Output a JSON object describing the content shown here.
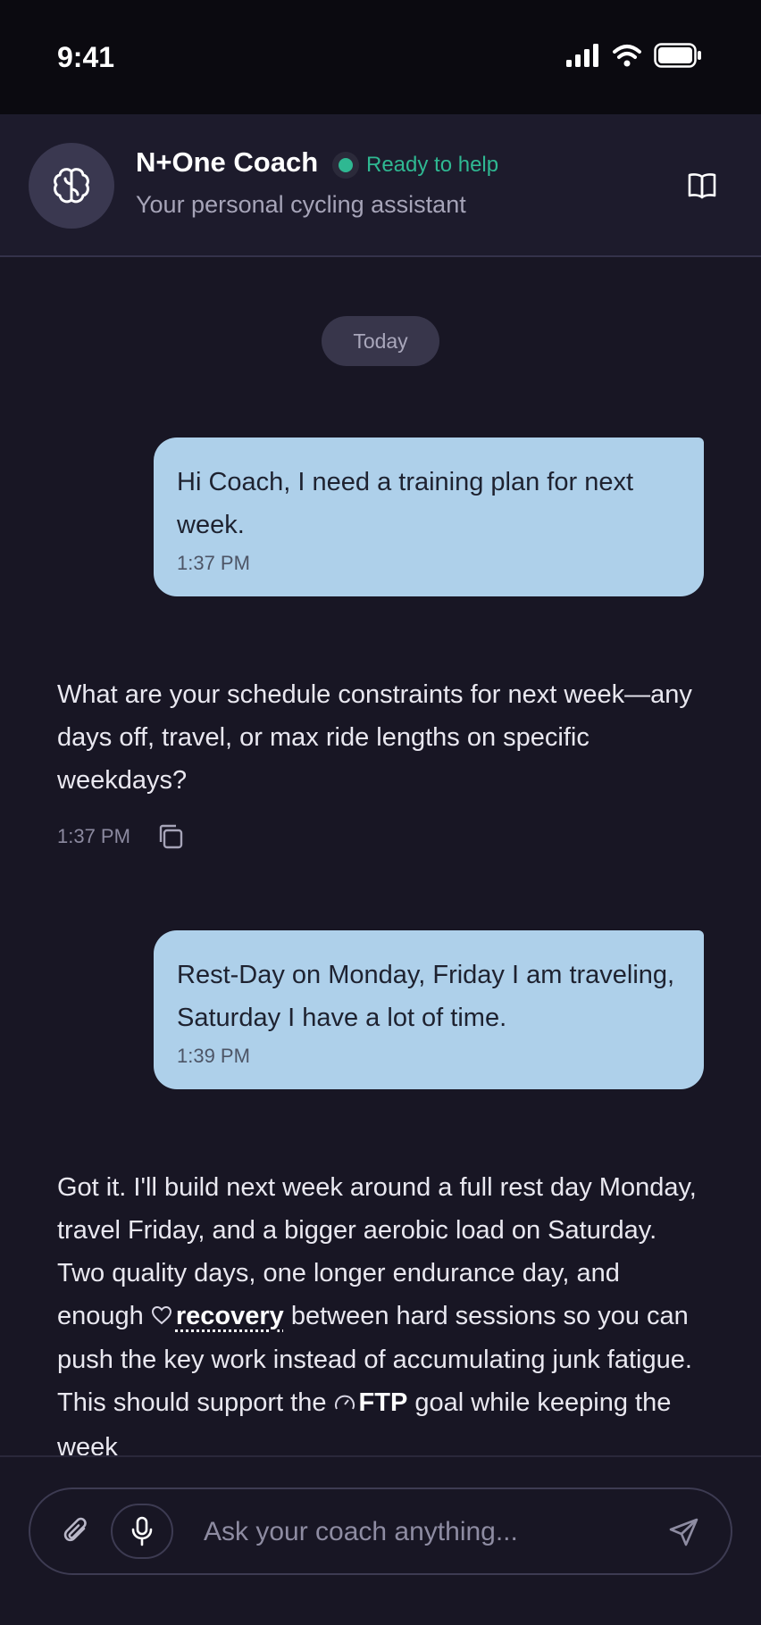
{
  "status_bar": {
    "time": "9:41",
    "icons": [
      "signal-icon",
      "wifi-icon",
      "battery-icon"
    ]
  },
  "header": {
    "coach_name": "N+One Coach",
    "status": "Ready to help",
    "subtitle": "Your personal cycling assistant",
    "avatar_icon": "brain-icon",
    "action_icon": "book-icon"
  },
  "chat": {
    "date_chip": "Today",
    "messages": [
      {
        "role": "user",
        "text": "Hi Coach, I need a training plan for next week.",
        "time": "1:37 PM"
      },
      {
        "role": "coach",
        "text": "What are your schedule constraints for next week—any days off, travel, or max ride lengths on specific weekdays?",
        "time": "1:37 PM"
      },
      {
        "role": "user",
        "text": "Rest-Day on Monday, Friday I am traveling, Saturday I have a lot of time.",
        "time": "1:39 PM"
      },
      {
        "role": "coach",
        "text_part1": "Got it. I'll build next week around a full rest day Monday, travel Friday, and a bigger aerobic load on Saturday. Two quality days, one longer endurance day, and enough",
        "term1": "recovery",
        "term1_icon": "heart-icon",
        "text_part2": "between hard sessions so you can push the key work instead of accumulating junk fatigue. This should support the",
        "term2": "FTP",
        "term2_icon": "gauge-icon",
        "text_part3": "goal while keeping the week"
      }
    ]
  },
  "composer": {
    "placeholder": "Ask your coach anything...",
    "value": "",
    "icons": [
      "paperclip-icon",
      "microphone-icon",
      "send-icon"
    ]
  },
  "colors": {
    "background": "#181624",
    "accent_green": "#2fb892",
    "user_bubble": "#aed0ea"
  }
}
